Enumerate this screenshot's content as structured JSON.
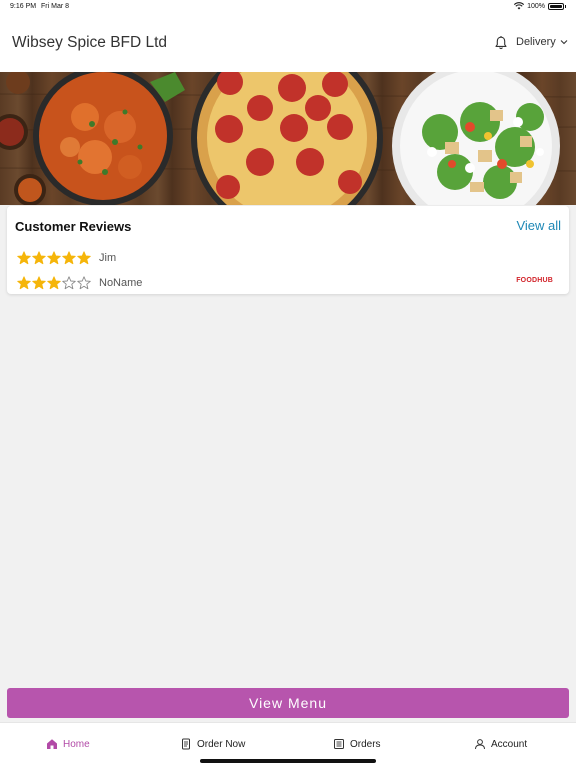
{
  "status_bar": {
    "time": "9:16 PM",
    "date": "Fri Mar 8",
    "battery": "100%"
  },
  "header": {
    "title": "Wibsey Spice BFD Ltd",
    "order_mode": "Delivery"
  },
  "reviews": {
    "title": "Customer Reviews",
    "view_all_label": "View all",
    "items": [
      {
        "name": "Jim",
        "rating": 5,
        "max": 5
      },
      {
        "name": "NoName",
        "rating": 3,
        "max": 5
      }
    ],
    "source_logo": "FOODHUB"
  },
  "view_menu_label": "View Menu",
  "tab_bar": {
    "items": [
      {
        "label": "Home",
        "icon": "home-icon",
        "active": true
      },
      {
        "label": "Order Now",
        "icon": "order-icon",
        "active": false
      },
      {
        "label": "Orders",
        "icon": "orders-list-icon",
        "active": false
      },
      {
        "label": "Account",
        "icon": "account-icon",
        "active": false
      }
    ]
  },
  "colors": {
    "accent": "#b755ad",
    "link": "#1e88b6",
    "star": "#f5b50a",
    "brand_red": "#d2232a"
  }
}
